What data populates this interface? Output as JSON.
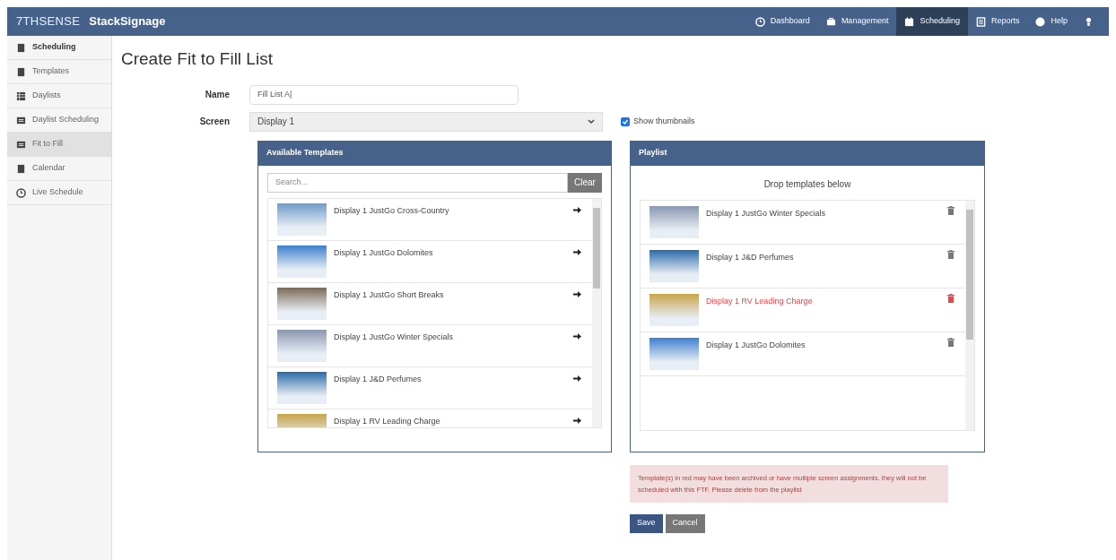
{
  "brand": {
    "logo": "7THSENSE",
    "product": "StackSignage"
  },
  "nav": [
    {
      "label": "Dashboard",
      "selected": false
    },
    {
      "label": "Management",
      "selected": false
    },
    {
      "label": "Scheduling",
      "selected": true
    },
    {
      "label": "Reports",
      "selected": false
    },
    {
      "label": "Help",
      "selected": false
    },
    {
      "selected": false
    }
  ],
  "sidebar": {
    "heading": "Scheduling",
    "items": [
      {
        "label": "Templates",
        "selected": false
      },
      {
        "label": "Daylists",
        "selected": false
      },
      {
        "label": "Daylist Scheduling",
        "selected": false
      },
      {
        "label": "Fit to Fill",
        "selected": true
      },
      {
        "label": "Calendar",
        "selected": false
      },
      {
        "label": "Live Schedule",
        "selected": false
      }
    ]
  },
  "page_title": "Create Fit to Fill List",
  "form": {
    "name_label": "Name",
    "name_value": "Fill List A|",
    "screen_label": "Screen",
    "screen_value": "Display 1",
    "show_thumbnails": {
      "label": "Show thumbnails",
      "checked": true
    }
  },
  "available": {
    "title": "Available Templates",
    "search_placeholder": "Search...",
    "clear": "Clear",
    "items": [
      {
        "name": "Display 1 JustGo Cross-Country"
      },
      {
        "name": "Display 1 JustGo Dolomites"
      },
      {
        "name": "Display 1 JustGo Short Breaks"
      },
      {
        "name": "Display 1 JustGo Winter Specials"
      },
      {
        "name": "Display 1 J&D Perfumes"
      },
      {
        "name": "Display 1 RV Leading Charge"
      }
    ]
  },
  "playlist": {
    "title": "Playlist",
    "hint": "Drop templates below",
    "items": [
      {
        "name": "Display 1 JustGo Winter Specials",
        "invalid": false
      },
      {
        "name": "Display 1 J&D Perfumes",
        "invalid": false
      },
      {
        "name": "Display 1 RV Leading Charge",
        "invalid": true
      },
      {
        "name": "Display 1 JustGo Dolomites",
        "invalid": false
      }
    ]
  },
  "alert": "Template(s) in red may have been archived or have multiple screen assignments. they will not be scheduled with this FTF. Please delete from the playlist",
  "buttons": {
    "save": "Save",
    "cancel": "Cancel"
  }
}
